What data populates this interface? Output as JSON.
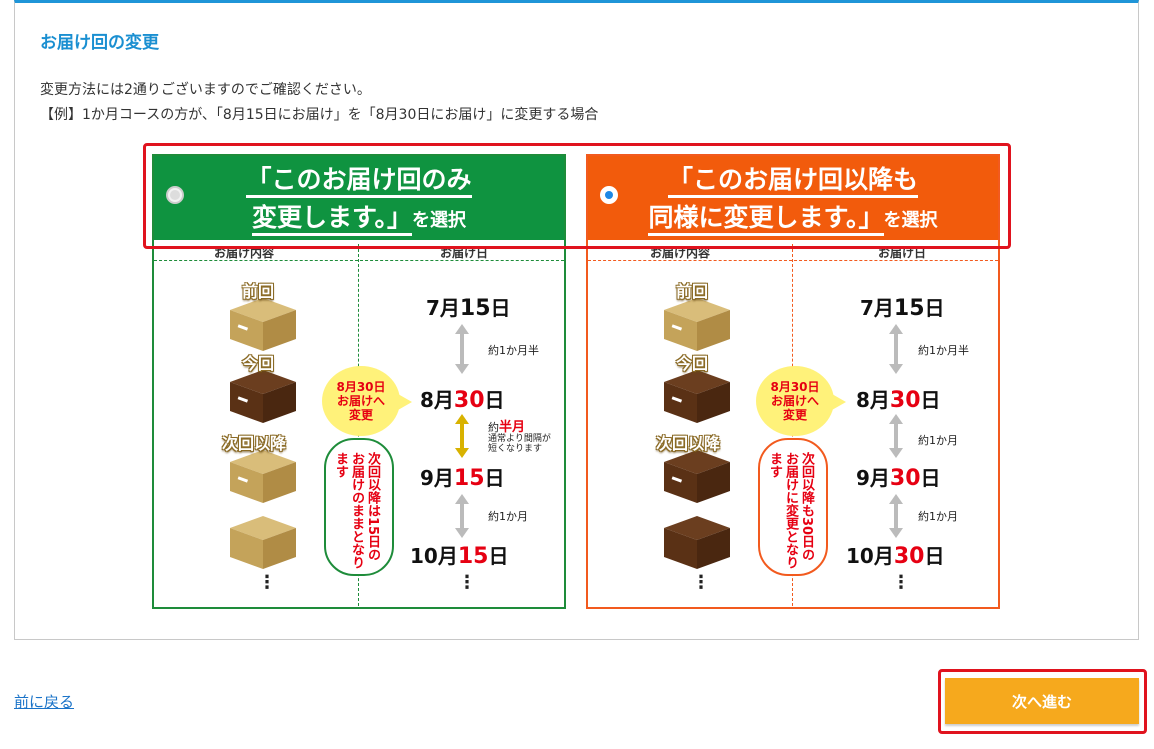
{
  "section": {
    "title": "お届け回の変更",
    "desc1": "変更方法には2通りございますのでご確認ください。",
    "desc2": "【例】1か月コースの方が、「8月15日にお届け」を「8月30日にお届け」に変更する場合"
  },
  "options": [
    {
      "title_line1": "「このお届け回のみ",
      "title_line2": "変更します。」",
      "suffix": "を選択",
      "selected": false,
      "col_items": "お届け内容",
      "col_dates": "お届け日",
      "box_labels": [
        "前回",
        "今回",
        "次回以降"
      ],
      "change_bubble": [
        "8月30日",
        "お届けへ",
        "変更"
      ],
      "keep_bubble": "次回以降は15日のお届けのままとなります",
      "dates": [
        {
          "m": "7月",
          "d": "15",
          "suffix": "日",
          "red": false
        },
        {
          "m": "8月",
          "d": "30",
          "suffix": "日",
          "red": true
        },
        {
          "m": "9月",
          "d": "15",
          "suffix": "日",
          "red": true
        },
        {
          "m": "10月",
          "d": "15",
          "suffix": "日",
          "red": true
        }
      ],
      "gaps": [
        "約1か月半",
        "約",
        "半月",
        "通常より間隔が",
        "短くなります",
        "約1か月"
      ]
    },
    {
      "title_line1": "「このお届け回以降も",
      "title_line2": "同様に変更します。」",
      "suffix": "を選択",
      "selected": true,
      "col_items": "お届け内容",
      "col_dates": "お届け日",
      "box_labels": [
        "前回",
        "今回",
        "次回以降"
      ],
      "change_bubble": [
        "8月30日",
        "お届けへ",
        "変更"
      ],
      "keep_bubble": "次回以降も30日のお届けに変更となります",
      "dates": [
        {
          "m": "7月",
          "d": "15",
          "suffix": "日",
          "red": false
        },
        {
          "m": "8月",
          "d": "30",
          "suffix": "日",
          "red": true
        },
        {
          "m": "9月",
          "d": "30",
          "suffix": "日",
          "red": true
        },
        {
          "m": "10月",
          "d": "30",
          "suffix": "日",
          "red": true
        }
      ],
      "gaps": [
        "約1か月半",
        "約1か月",
        "約1か月"
      ]
    }
  ],
  "footer": {
    "back": "前に戻る",
    "next": "次へ進む"
  },
  "colors": {
    "accent_blue": "#1a8fd1",
    "green": "#0f9340",
    "orange": "#f25b0c",
    "button": "#f6a91d",
    "highlight": "#e0131e"
  }
}
